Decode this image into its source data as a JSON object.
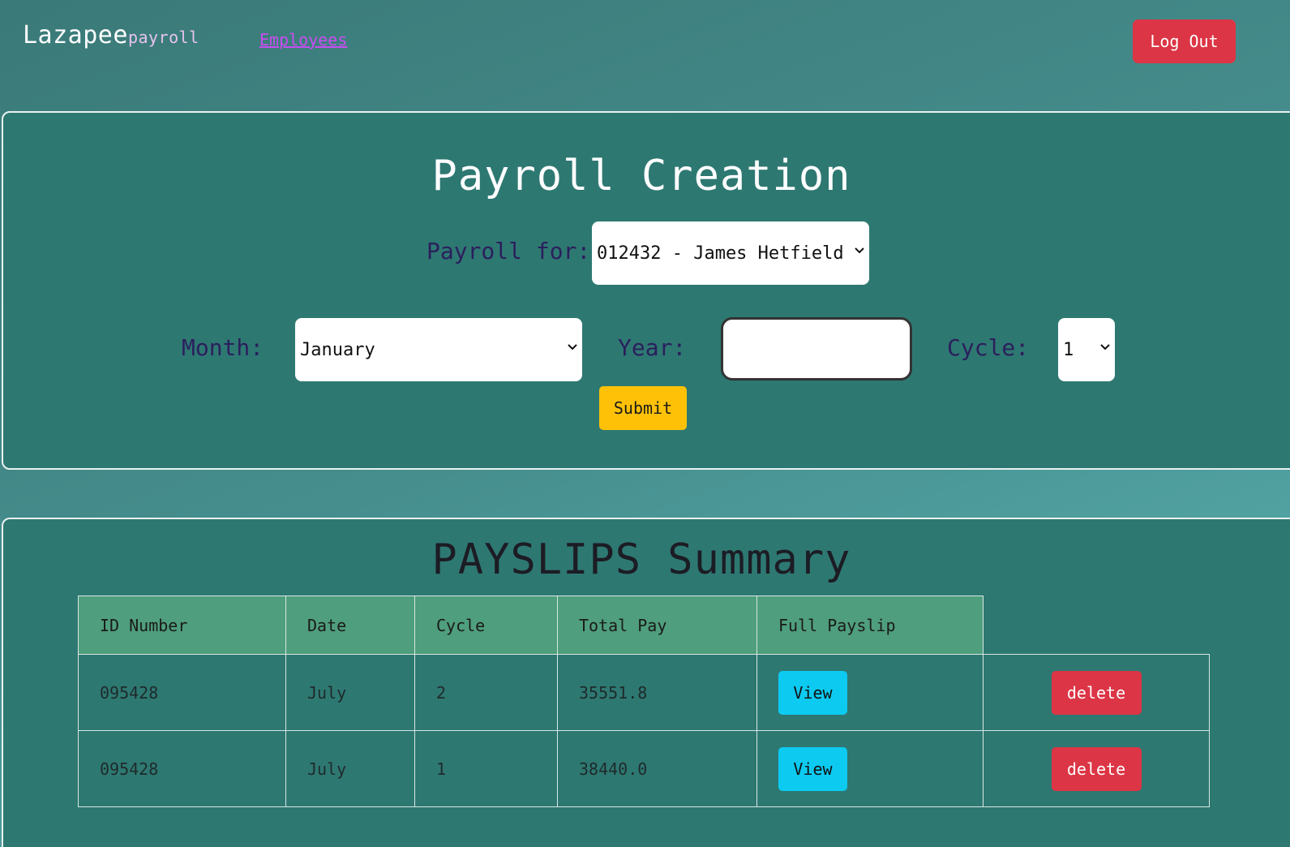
{
  "navbar": {
    "brand": "Lazapee",
    "brand_sub": "payroll",
    "employees_link": "Employees",
    "logout_label": "Log Out"
  },
  "creation": {
    "heading": "Payroll Creation",
    "payroll_for_label": "Payroll for:",
    "payroll_for_value": "012432 - James Hetfield",
    "month_label": "Month:",
    "month_value": "January",
    "year_label": "Year:",
    "year_value": "",
    "cycle_label": "Cycle:",
    "cycle_value": "1",
    "submit_label": "Submit"
  },
  "summary": {
    "heading": "PAYSLIPS Summary",
    "columns": [
      "ID Number",
      "Date",
      "Cycle",
      "Total Pay",
      "Full Payslip"
    ],
    "rows": [
      {
        "id": "095428",
        "date": "July",
        "cycle": "2",
        "total_pay": "35551.8",
        "view_label": "View",
        "delete_label": "delete"
      },
      {
        "id": "095428",
        "date": "July",
        "cycle": "1",
        "total_pay": "38440.0",
        "view_label": "View",
        "delete_label": "delete"
      }
    ]
  },
  "icons": {
    "select_arrow": "chevron-down-icon"
  },
  "colors": {
    "danger": "#dc3545",
    "warning": "#ffc107",
    "info": "#0dcaf0",
    "card": "#2e7872",
    "table_header": "#4f9e7d"
  }
}
